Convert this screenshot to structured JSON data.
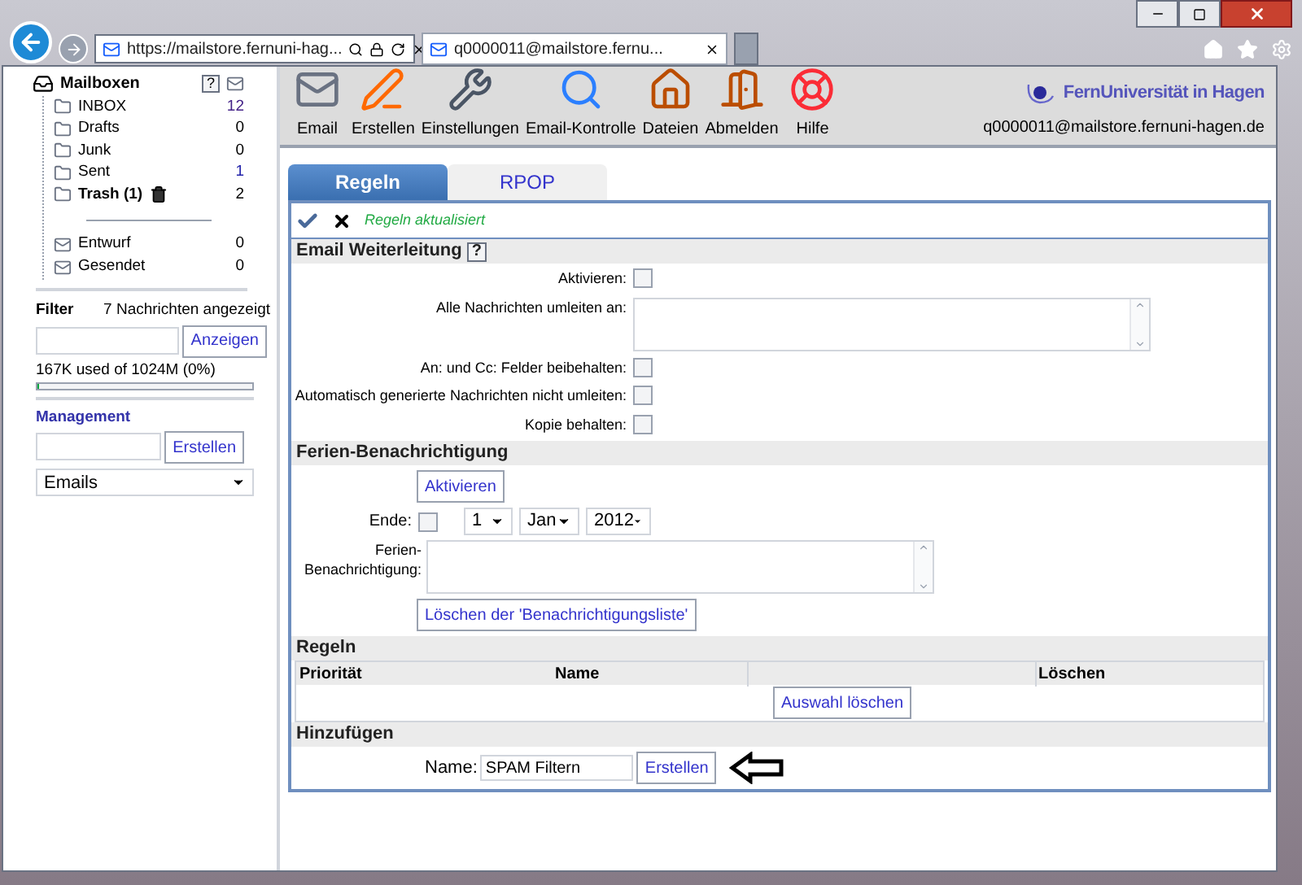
{
  "browser": {
    "address": "https://mailstore.fernuni-hag...",
    "tab_title": "q0000011@mailstore.fernu..."
  },
  "sidebar": {
    "title": "Mailboxen",
    "help": "?",
    "folders": [
      {
        "name": "INBOX",
        "count": "12",
        "bold": false,
        "trash": false
      },
      {
        "name": "Drafts",
        "count": "0",
        "bold": false,
        "trash": false
      },
      {
        "name": "Junk",
        "count": "0",
        "bold": false,
        "trash": false
      },
      {
        "name": "Sent",
        "count": "1",
        "bold": false,
        "trash": false
      },
      {
        "name": "Trash (1)",
        "count": "2",
        "bold": true,
        "trash": true
      }
    ],
    "other_folders": [
      {
        "name": "Entwurf",
        "count": "0"
      },
      {
        "name": "Gesendet",
        "count": "0"
      }
    ],
    "filter": {
      "label": "Filter",
      "status": "7 Nachrichten angezeigt",
      "button": "Anzeigen"
    },
    "quota": {
      "text": "167K used of 1024M  (0%)",
      "level": 0.01
    },
    "management": {
      "label": "Management",
      "button": "Erstellen",
      "select": "Emails"
    }
  },
  "toolbar": {
    "items": [
      {
        "label": "Email",
        "kind": "mail"
      },
      {
        "label": "Erstellen",
        "kind": "compose"
      },
      {
        "label": "Einstellungen",
        "kind": "tools"
      },
      {
        "label": "Email-Kontrolle",
        "kind": "search"
      },
      {
        "label": "Dateien",
        "kind": "house"
      },
      {
        "label": "Abmelden",
        "kind": "door"
      },
      {
        "label": "Hilfe",
        "kind": "help"
      }
    ],
    "logo": "FernUniversität in Hagen",
    "user": "q0000011@mailstore.fernuni-hagen.de"
  },
  "tabs": [
    {
      "label": "Regeln",
      "selected": true
    },
    {
      "label": "RPOP",
      "selected": false
    }
  ],
  "status": "Regeln aktualisiert",
  "forwarding": {
    "title": "Email Weiterleitung",
    "help": "?",
    "rows": [
      {
        "kind": "checkbox",
        "label": "Aktivieren:",
        "checked": false
      },
      {
        "kind": "textarea",
        "label": "Alle Nachrichten umleiten an:"
      },
      {
        "kind": "checkbox",
        "label": "An: und Cc: Felder beibehalten:",
        "checked": false
      },
      {
        "kind": "checkbox",
        "label": "Automatisch generierte Nachrichten nicht umleiten:",
        "checked": false
      },
      {
        "kind": "checkbox",
        "label": "Kopie behalten:",
        "checked": false
      }
    ]
  },
  "vacation": {
    "title": "Ferien-Benachrichtigung",
    "activate": "Aktivieren",
    "end_label": "Ende:",
    "end_checked": false,
    "day": "1",
    "month": "Jan",
    "year": "2012",
    "message_label": "Ferien-\nBenachrichtigung:",
    "clear_button": "Löschen der 'Benachrichtigungsliste'"
  },
  "rules": {
    "title": "Regeln",
    "columns": [
      "Priorität",
      "Name",
      "Löschen"
    ],
    "delete_button": "Auswahl löschen"
  },
  "add": {
    "title": "Hinzufügen",
    "name_label": "Name:",
    "name_value": "SPAM Filtern",
    "button": "Erstellen"
  }
}
